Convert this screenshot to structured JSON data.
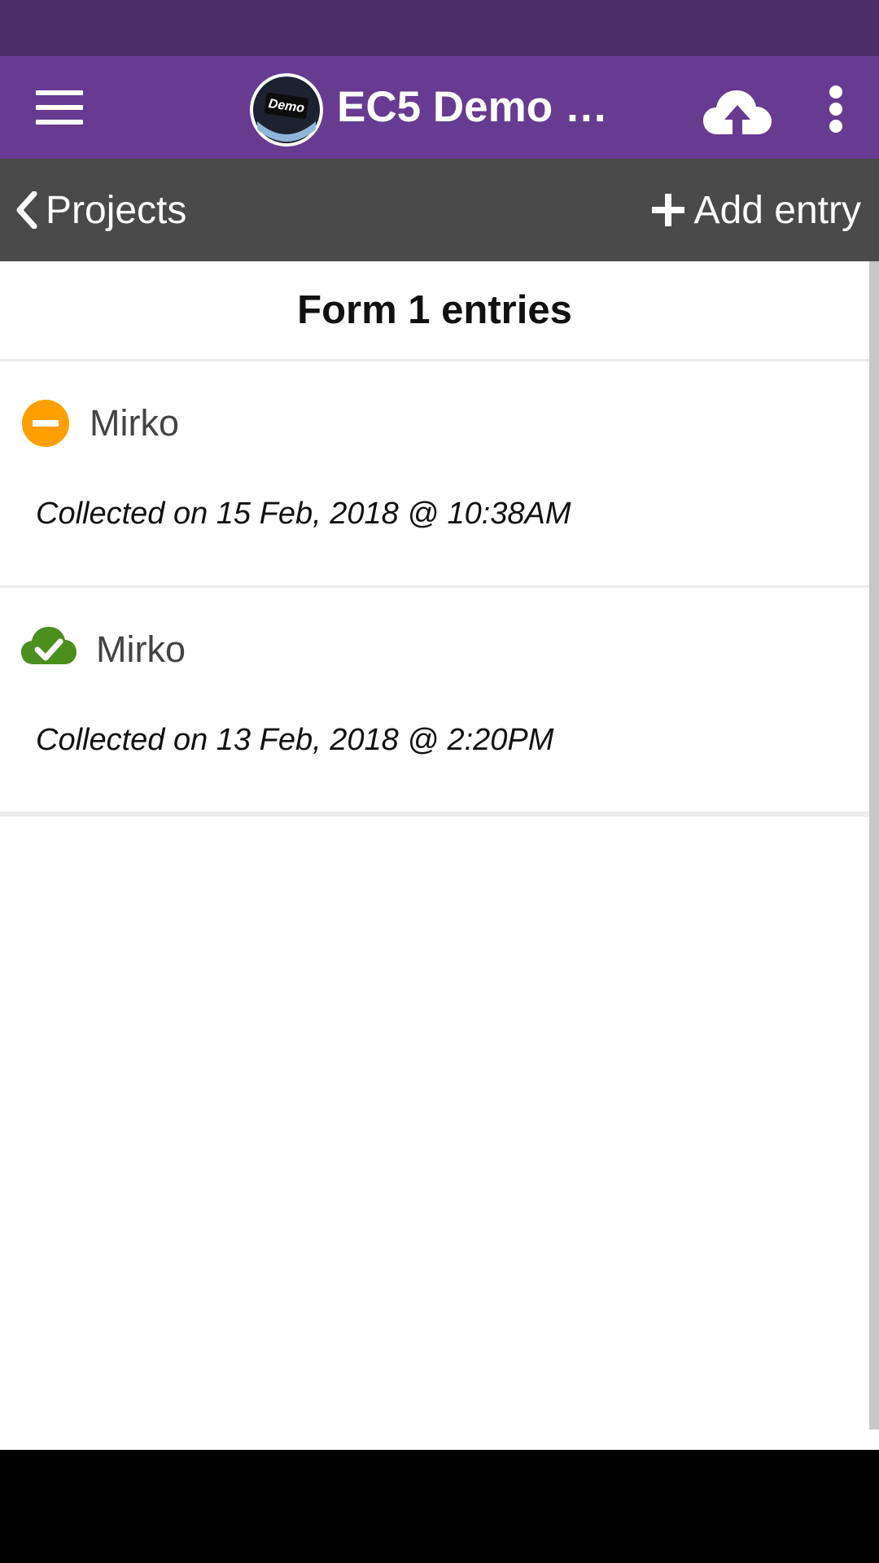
{
  "header": {
    "title": "EC5 Demo Pr...",
    "logo_text": "Demo",
    "colors": {
      "status_bar": "#4e2d6b",
      "app_bar": "#673c90"
    }
  },
  "nav": {
    "back_label": "Projects",
    "add_label": "Add entry",
    "color": "#4a4a4a"
  },
  "page": {
    "title": "Form 1 entries"
  },
  "entries": [
    {
      "name": "Mirko",
      "collected": "Collected on 15 Feb, 2018 @ 10:38AM",
      "status_icon": "unsynced-minus-icon",
      "status_color": "#ffa000"
    },
    {
      "name": "Mirko",
      "collected": "Collected on 13 Feb, 2018 @ 2:20PM",
      "status_icon": "synced-cloud-check-icon",
      "status_color": "#4b8f1f"
    }
  ]
}
